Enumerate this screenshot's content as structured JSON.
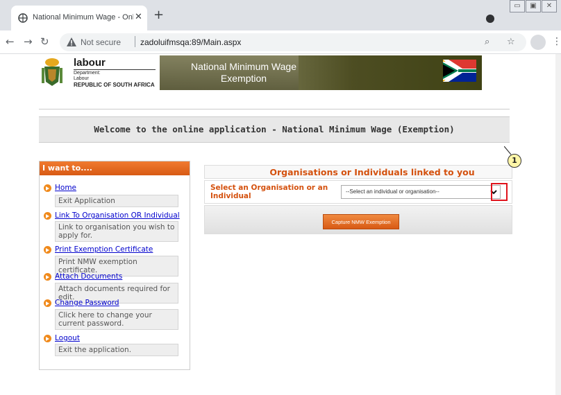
{
  "browser": {
    "tab_title": "National Minimum Wage - Onlin",
    "tab_close_glyph": "✕",
    "new_tab_glyph": "+",
    "not_secure_label": "Not secure",
    "url": "zadoluifmsqa:89/Main.aspx",
    "window_buttons": [
      "▭",
      "▣",
      "✕"
    ],
    "icons": [
      "back-icon",
      "forward-icon",
      "reload-icon",
      "search-icon",
      "star-icon",
      "profile-icon",
      "menu-icon"
    ]
  },
  "header": {
    "logo_labour": "labour",
    "logo_dept_line1": "Department:",
    "logo_dept_line2": "Labour",
    "logo_country": "REPUBLIC OF SOUTH AFRICA",
    "banner_title": "National Minimum Wage Exemption"
  },
  "welcome": {
    "text": "Welcome to the online application - National Minimum Wage (Exemption)"
  },
  "sidebar": {
    "title": "I want to....",
    "items": [
      {
        "link": "Home",
        "description": "Exit Application"
      },
      {
        "link": "Link To Organisation OR Individual",
        "description": "Link to organisation you wish to apply for."
      },
      {
        "link": "Print Exemption Certificate",
        "description": "Print NMW exemption certificate."
      },
      {
        "link": "Attach Documents",
        "description": "Attach documents required for edit."
      },
      {
        "link": "Change Password",
        "description": "Click here to change your current password."
      },
      {
        "link": "Logout",
        "description": "Exit the application."
      }
    ]
  },
  "main": {
    "panel_title": "Organisations or Individuals linked to you",
    "select_label": "Select an Organisation or an Individual",
    "select_value": "--Select an individual or organisation--",
    "capture_button": "Capture NMW Exemption",
    "callout_number": "1"
  },
  "colors": {
    "accent": "#d4510e",
    "link": "#0000cc",
    "highlight_box": "#e0121b",
    "callout_fill": "#fff6a8"
  }
}
